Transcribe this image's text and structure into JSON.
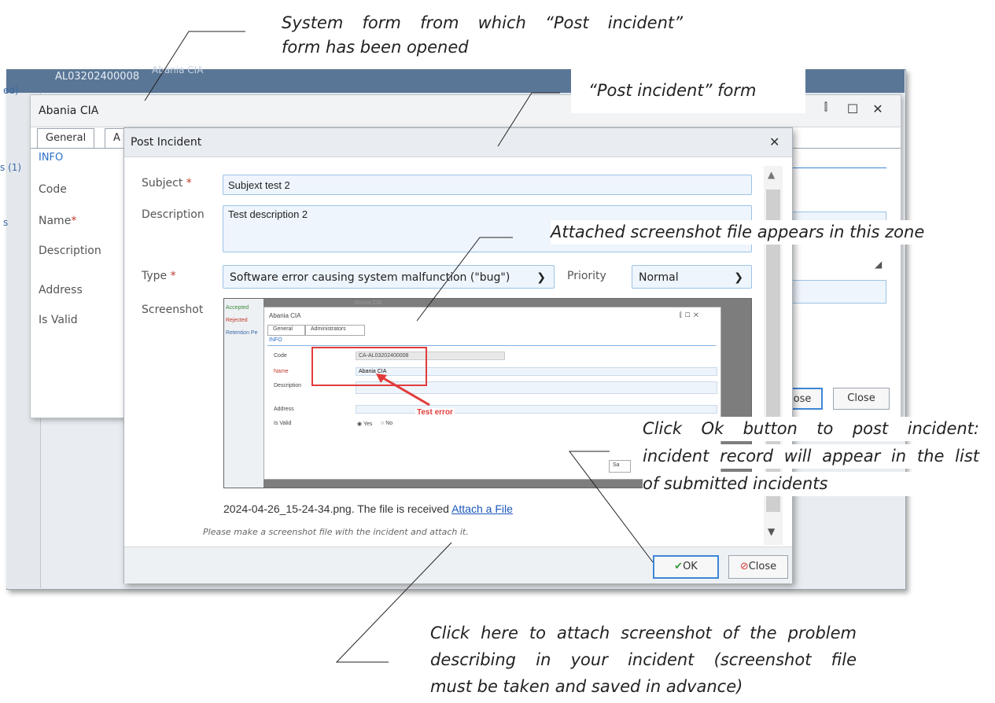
{
  "annotations": {
    "system_form": "System form from which “Post incident” form has been opened",
    "system_form_line1": "System form from which “Post incident”",
    "system_form_line2": "form has been opened",
    "post_incident_form": "“Post incident” form",
    "attached_zone": "Attached screenshot file appears in this zone",
    "ok_line1": "Click Ok button to post incident:",
    "ok_line2": "incident record will appear in the list",
    "ok_line3": "of submitted incidents",
    "attach_line1": "Click here to attach screenshot of the problem",
    "attach_line2": "describing in your incident (screenshot file",
    "attach_line3": "must be taken and saved in advance)"
  },
  "system_window": {
    "header_code": "AL03202400008",
    "header_name": "Abania CIA",
    "side_fragments": [
      "ed)",
      "s (1)",
      "s"
    ]
  },
  "abania_dialog": {
    "title": "Abania CIA",
    "tabs": [
      "General",
      "A"
    ],
    "section": "INFO",
    "fields": [
      "Code",
      "Name",
      "Description",
      "Address",
      "Is Valid"
    ],
    "buttons": {
      "save_fragment": "ose",
      "close": "Close"
    }
  },
  "post_incident": {
    "title": "Post Incident",
    "subject_label": "Subject",
    "subject_value": "Subjext test 2",
    "description_label": "Description",
    "description_value": "Test description 2",
    "type_label": "Type",
    "type_value": "Software error causing system malfunction (\"bug\")",
    "priority_label": "Priority",
    "priority_value": "Normal",
    "screenshot_label": "Screenshot",
    "file_status": "2024-04-26_15-24-34.png. The file is received",
    "attach_link": "Attach a File",
    "hint": "Please make a screenshot file with the incident and attach it.",
    "ok_label": "OK",
    "close_label": "Close"
  },
  "embedded_screenshot": {
    "side_items": [
      "Accepted",
      "Rejected",
      "Retention Pe"
    ],
    "header_fragment": "Abania CIA",
    "title": "Abania CIA",
    "tabs": [
      "General",
      "Administrators"
    ],
    "section": "INFO",
    "labels": [
      "Code",
      "Name",
      "Description",
      "Address",
      "Is Valid"
    ],
    "code_value": "CA-AL03202400008",
    "name_value": "Abania CIA",
    "radio_yes": "Yes",
    "radio_no": "No",
    "error_label": "Test error",
    "save_fragment": "Sa"
  },
  "colors": {
    "accent": "#3d86d6",
    "header_blue": "#5a7696",
    "error_red": "#e23b3b"
  }
}
